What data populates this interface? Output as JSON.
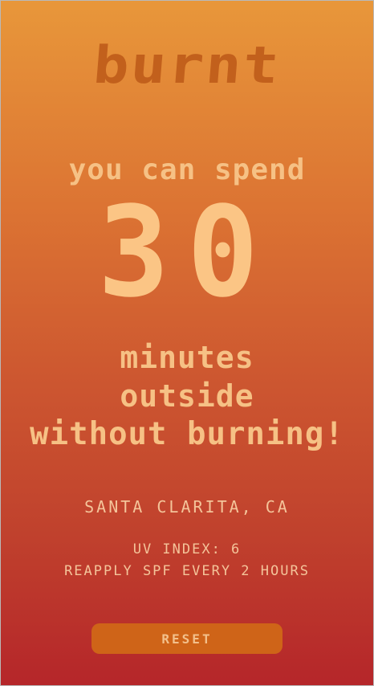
{
  "app": {
    "logo_text": "burnt"
  },
  "result": {
    "lead_text": "you can spend",
    "minutes": "30",
    "line1": "minutes",
    "line2": "outside",
    "line3": "without burning!"
  },
  "details": {
    "location": "SANTA CLARITA, CA",
    "uv_index": "UV INDEX: 6",
    "reapply": "REAPPLY SPF EVERY 2 HOURS"
  },
  "actions": {
    "reset_label": "RESET"
  },
  "colors": {
    "gradient_top": "#e8973a",
    "gradient_bottom": "#b5262a",
    "text": "#f6c185",
    "button": "#cf6418"
  }
}
